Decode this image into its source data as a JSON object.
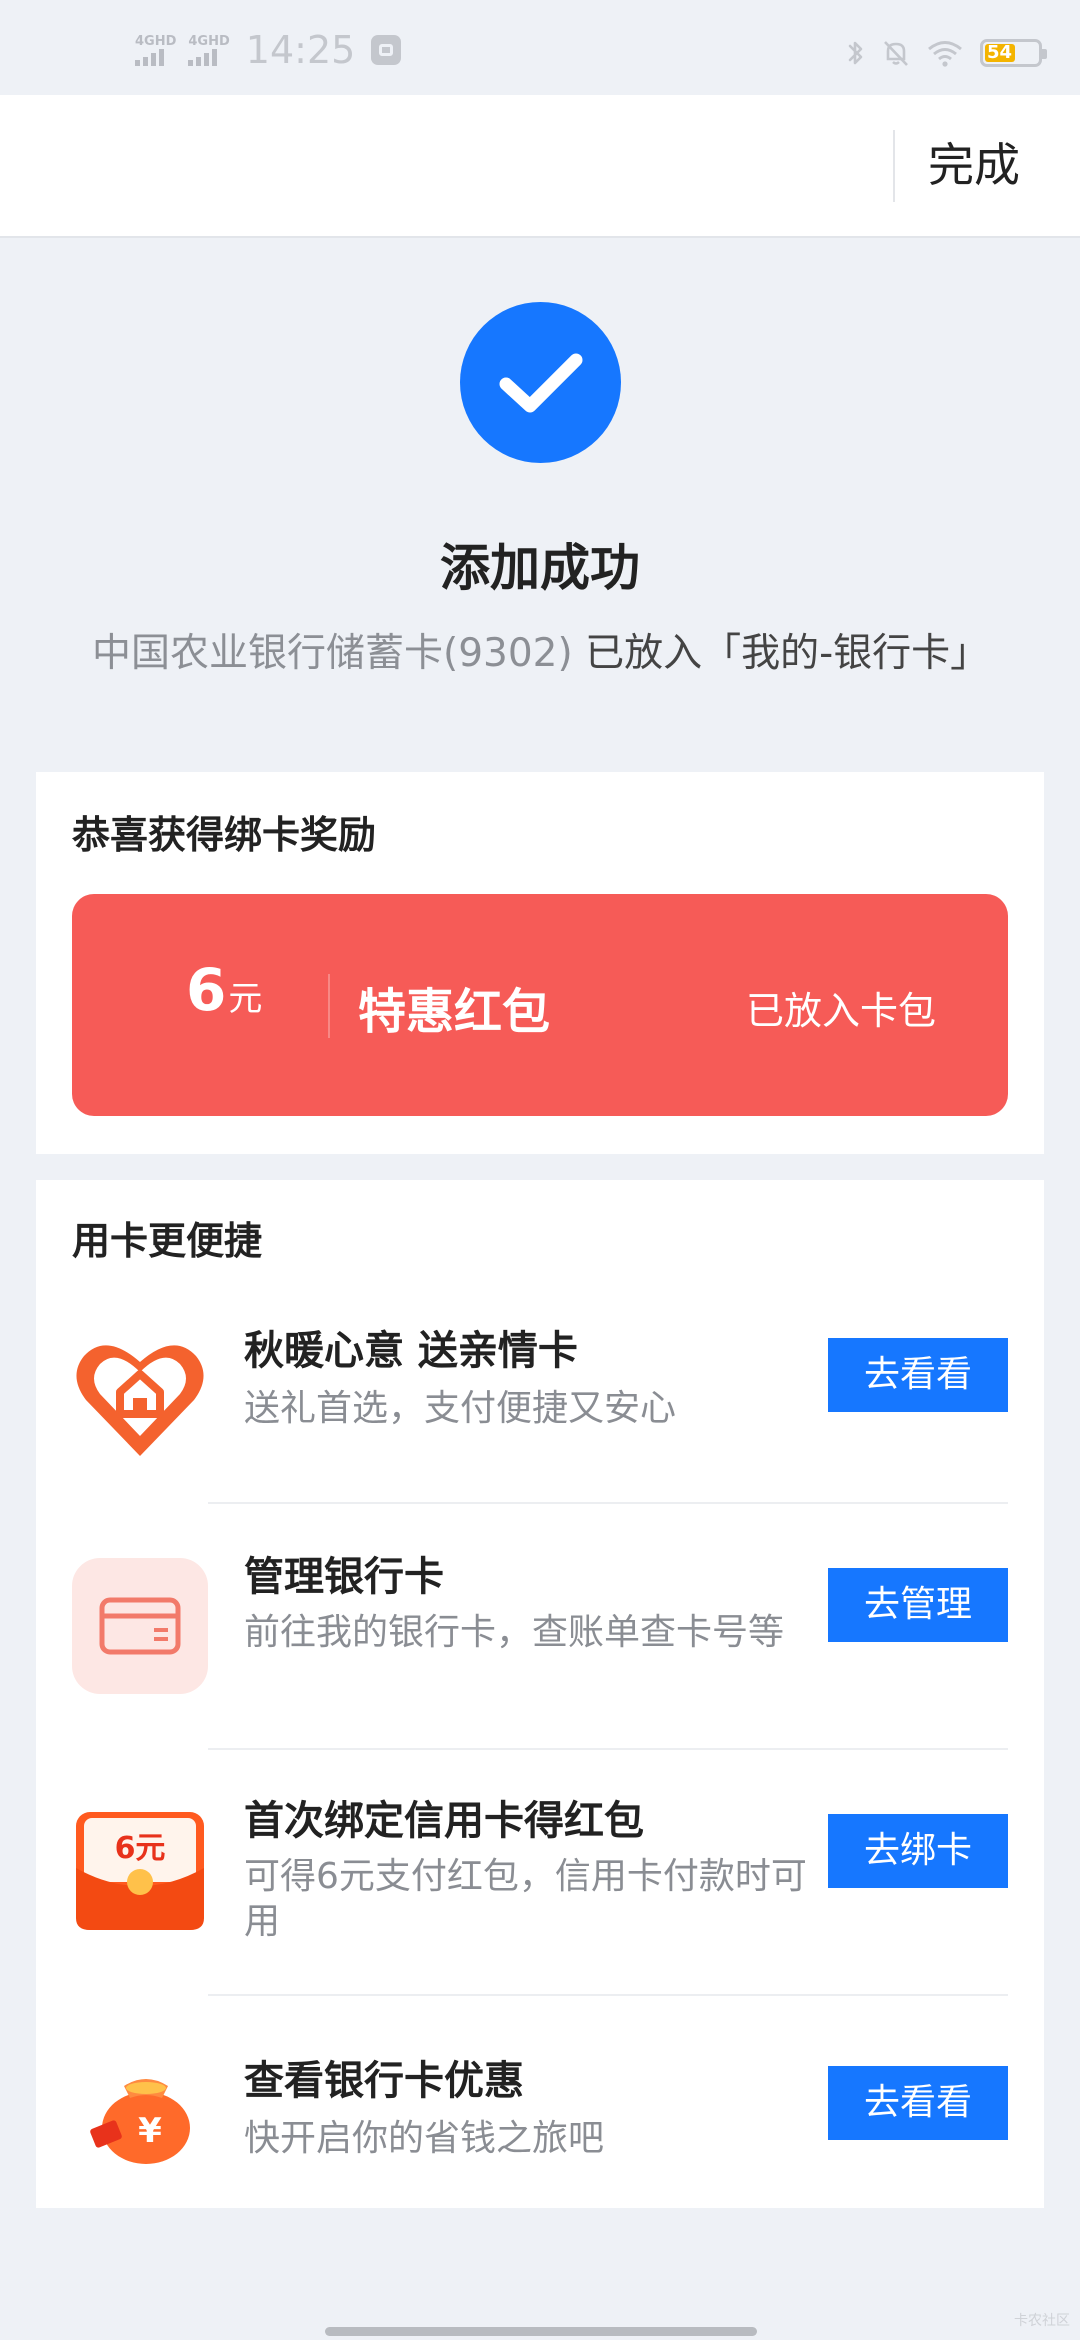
{
  "status_bar": {
    "network_1": "4G",
    "network_1_sub": "HD",
    "network_2": "4G",
    "network_2_sub": "HD",
    "time": "14:25",
    "battery": "54"
  },
  "header": {
    "done_label": "完成"
  },
  "success": {
    "title": "添加成功",
    "card_name": "中国农业银行储蓄卡(9302)",
    "placed_text": " 已放入「我的-银行卡」"
  },
  "reward": {
    "title": "恭喜获得绑卡奖励",
    "amount": "6",
    "unit": "元",
    "name": "特惠红包",
    "status": "已放入卡包"
  },
  "more": {
    "title": "用卡更便捷",
    "items": [
      {
        "title": "秋暖心意  送亲情卡",
        "subtitle": "送礼首选，支付便捷又安心",
        "button": "去看看",
        "icon": "family-card-heart-icon"
      },
      {
        "title": "管理银行卡",
        "subtitle": "前往我的银行卡，查账单查卡号等",
        "button": "去管理",
        "icon": "bank-card-icon"
      },
      {
        "title": "首次绑定信用卡得红包",
        "subtitle": "可得6元支付红包，信用卡付款时可用",
        "button": "去绑卡",
        "icon": "red-envelope-icon",
        "icon_text": "6元"
      },
      {
        "title": "查看银行卡优惠",
        "subtitle": "快开启你的省钱之旅吧",
        "button": "去看看",
        "icon": "money-bag-icon",
        "icon_text": "¥"
      }
    ]
  },
  "colors": {
    "accent": "#1677ff",
    "reward_red": "#f65b57",
    "background": "#eef1f6"
  },
  "watermark": "卡农社区"
}
